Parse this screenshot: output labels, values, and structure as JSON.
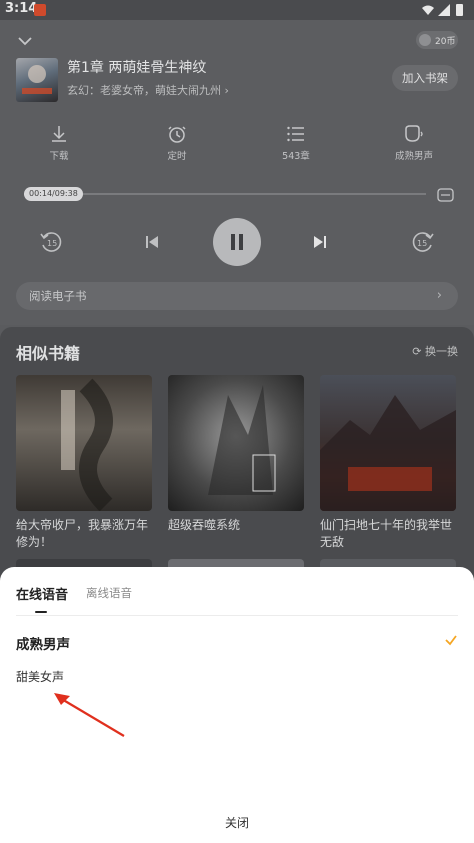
{
  "status_bar": {
    "time": "3:14"
  },
  "player": {
    "coin_label": "20币",
    "chapter_title": "第1章 两萌娃骨生神纹",
    "book_subtitle": "玄幻：老婆女帝，萌娃大闹九州 ›",
    "add_shelf_label": "加入书架",
    "tools": [
      {
        "icon": "download-icon",
        "label": "下载"
      },
      {
        "icon": "timer-icon",
        "label": "定时"
      },
      {
        "icon": "chapter-list-icon",
        "label": "543章"
      },
      {
        "icon": "voice-icon",
        "label": "成熟男声"
      }
    ],
    "time_readout": "00:14/09:38",
    "progress": 0.024,
    "read_ebook_label": "阅读电子书",
    "read_ebook_chevron": "›"
  },
  "similar": {
    "title": "相似书籍",
    "swap_label": "换一换",
    "books": [
      {
        "name": "给大帝收尸，我暴涨万年修为！"
      },
      {
        "name": "超级吞噬系统"
      },
      {
        "name": "仙门扫地七十年的我举世无敌"
      }
    ]
  },
  "voice_sheet": {
    "tabs": [
      "在线语音",
      "离线语音"
    ],
    "options": [
      {
        "label": "成熟男声",
        "selected": true
      },
      {
        "label": "甜美女声",
        "selected": false
      }
    ],
    "close_label": "关闭",
    "accent_color": "#f5a623",
    "annotation_color": "#e0301e"
  }
}
